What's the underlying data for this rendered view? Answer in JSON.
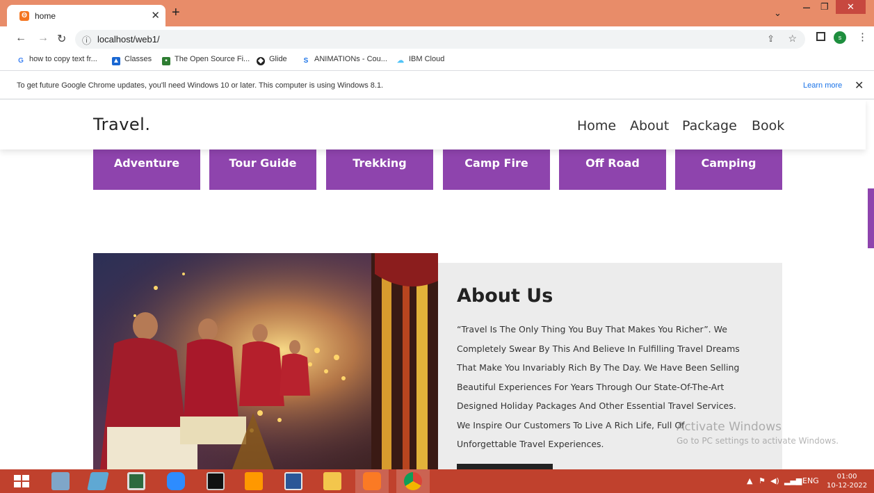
{
  "browser": {
    "tab_title": "home",
    "favicon_glyph": "Θ",
    "url": "localhost/web1/",
    "profile_initial": "s",
    "bookmarks": [
      {
        "label": "how to copy text fr...",
        "icon": "google-icon",
        "color": "#4285f4"
      },
      {
        "label": "Classes",
        "icon": "classes-icon",
        "color": "#1967d2"
      },
      {
        "label": "The Open Source Fi...",
        "icon": "open-source-icon",
        "color": "#2e7d32"
      },
      {
        "label": "Glide",
        "icon": "glide-icon",
        "color": "#222222"
      },
      {
        "label": "ANIMATIONs - Cou...",
        "icon": "s-icon",
        "color": "#1a73e8"
      },
      {
        "label": "IBM Cloud",
        "icon": "cloud-icon",
        "color": "#4fc3f7"
      }
    ],
    "infobar": {
      "message": "To get future Google Chrome updates, you'll need Windows 10 or later. This computer is using Windows 8.1.",
      "learn_more": "Learn more"
    }
  },
  "site": {
    "logo": "Travel.",
    "nav": [
      "Home",
      "About",
      "Package",
      "Book"
    ],
    "services": [
      "Adventure",
      "Tour Guide",
      "Trekking",
      "Camp Fire",
      "Off Road",
      "Camping"
    ],
    "about": {
      "title": "About Us",
      "lines": [
        "“Travel Is The Only Thing You Buy That Makes You Richer”. We",
        "Completely Swear By This And Believe In Fulfilling Travel Dreams",
        "That Make You Invariably Rich By The Day. We Have Been Selling",
        "Beautiful Experiences For Years Through Our State-Of-The-Art",
        "Designed Holiday Packages And Other Essential Travel Services.",
        "We Inspire Our Customers To Live A Rich Life, Full Of",
        "Unforgettable Travel Experiences."
      ]
    },
    "accent_color": "#8e44ad"
  },
  "watermark": {
    "line1": "Activate Windows",
    "line2": "Go to PC settings to activate Windows."
  },
  "taskbar": {
    "apps": [
      "start-icon",
      "photos-icon",
      "notes-icon",
      "task-manager-icon",
      "zoom-icon",
      "command-prompt-icon",
      "sublime-text-icon",
      "word-icon",
      "file-explorer-icon",
      "xampp-icon",
      "chrome-icon"
    ],
    "language": "ENG",
    "time": "01:00",
    "date": "10-12-2022"
  }
}
